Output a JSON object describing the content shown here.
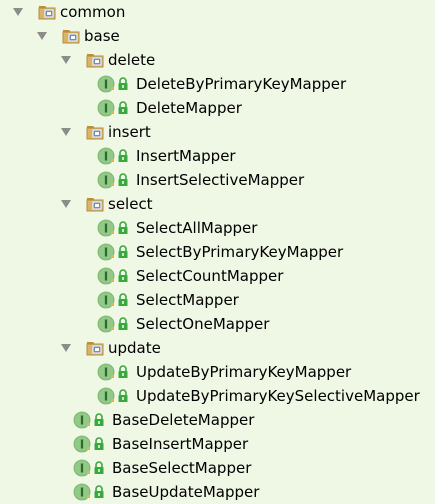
{
  "colors": {
    "background": "#eff7e5",
    "folder": "#d8b36a",
    "folder_dark": "#b98d3c",
    "package_badge": "#6a8cc0",
    "interface_circle": "#93c987",
    "interface_letter": "#2f6b2f",
    "lock": "#39a83d",
    "arrow": "#8c8c8c"
  },
  "tree": {
    "root": {
      "label": "common",
      "icon": "package-folder-icon",
      "expanded": true,
      "children": [
        {
          "label": "base",
          "icon": "package-folder-icon",
          "expanded": true,
          "children": [
            {
              "label": "delete",
              "icon": "package-folder-icon",
              "expanded": true,
              "children": [
                {
                  "label": "DeleteByPrimaryKeyMapper",
                  "icon": "interface-icon"
                },
                {
                  "label": "DeleteMapper",
                  "icon": "interface-icon"
                }
              ]
            },
            {
              "label": "insert",
              "icon": "package-folder-icon",
              "expanded": true,
              "children": [
                {
                  "label": "InsertMapper",
                  "icon": "interface-icon"
                },
                {
                  "label": "InsertSelectiveMapper",
                  "icon": "interface-icon"
                }
              ]
            },
            {
              "label": "select",
              "icon": "package-folder-icon",
              "expanded": true,
              "children": [
                {
                  "label": "SelectAllMapper",
                  "icon": "interface-icon"
                },
                {
                  "label": "SelectByPrimaryKeyMapper",
                  "icon": "interface-icon"
                },
                {
                  "label": "SelectCountMapper",
                  "icon": "interface-icon"
                },
                {
                  "label": "SelectMapper",
                  "icon": "interface-icon"
                },
                {
                  "label": "SelectOneMapper",
                  "icon": "interface-icon"
                }
              ]
            },
            {
              "label": "update",
              "icon": "package-folder-icon",
              "expanded": true,
              "children": [
                {
                  "label": "UpdateByPrimaryKeyMapper",
                  "icon": "interface-icon"
                },
                {
                  "label": "UpdateByPrimaryKeySelectiveMapper",
                  "icon": "interface-icon"
                }
              ]
            },
            {
              "label": "BaseDeleteMapper",
              "icon": "interface-icon"
            },
            {
              "label": "BaseInsertMapper",
              "icon": "interface-icon"
            },
            {
              "label": "BaseSelectMapper",
              "icon": "interface-icon"
            },
            {
              "label": "BaseUpdateMapper",
              "icon": "interface-icon"
            }
          ]
        }
      ]
    }
  }
}
